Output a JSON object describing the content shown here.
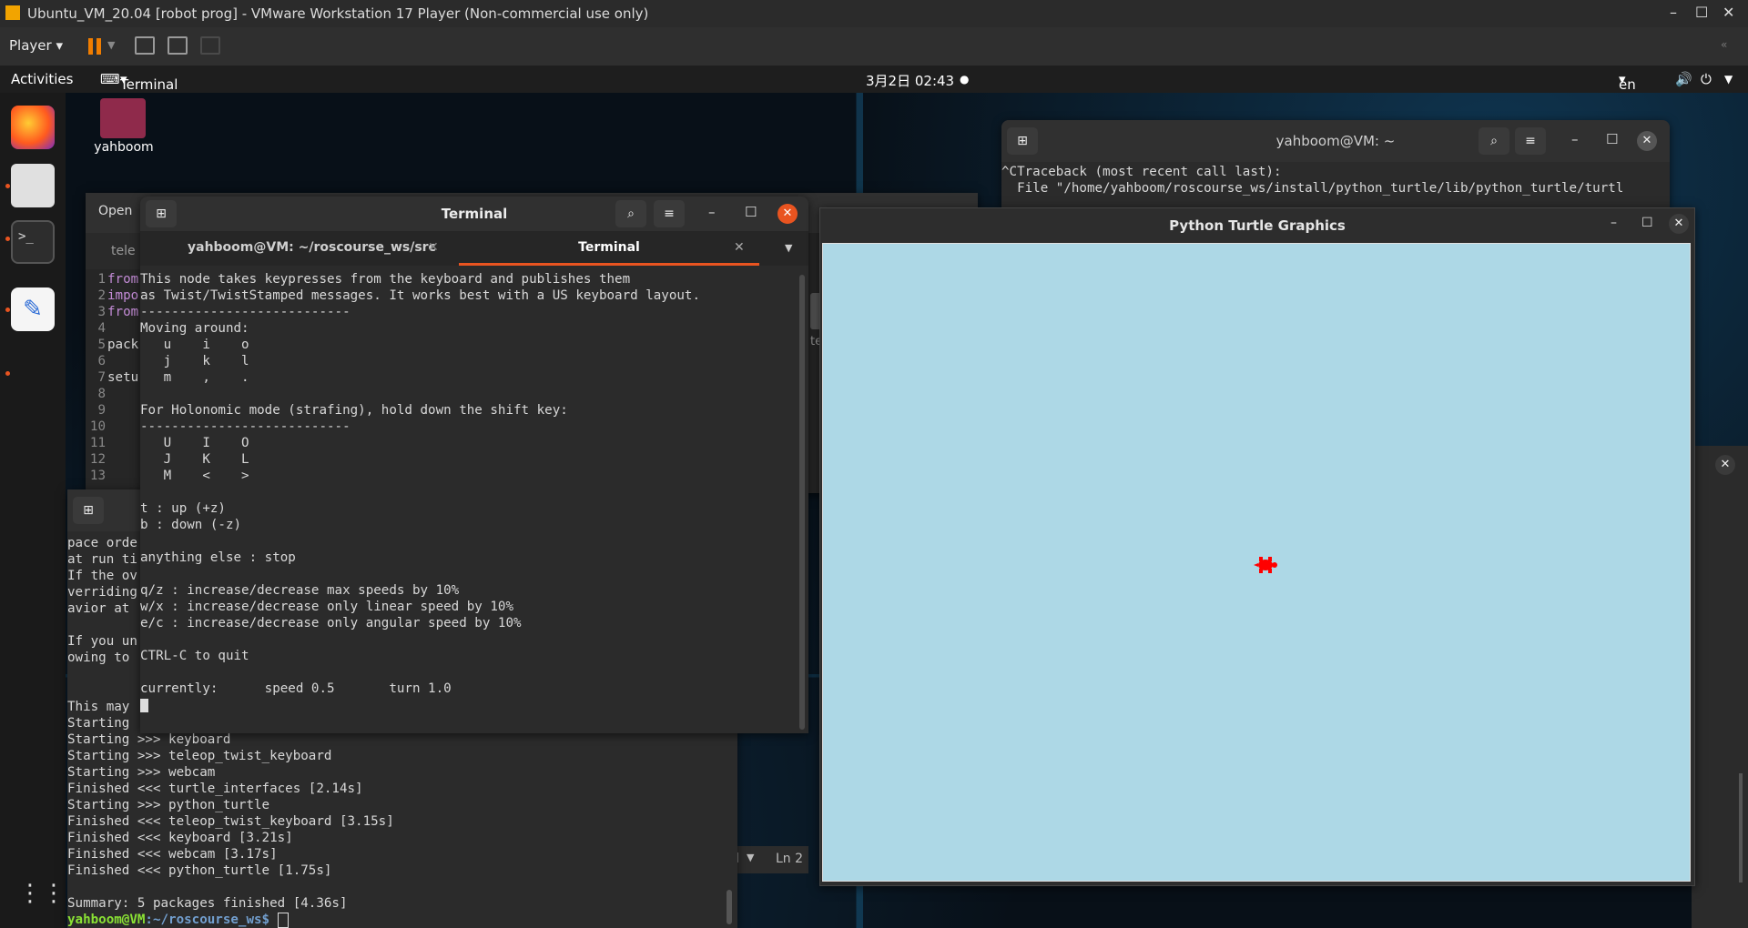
{
  "vmware": {
    "title": "Ubuntu_VM_20.04 [robot prog] - VMware Workstation 17 Player (Non-commercial use only)",
    "player_label": "Player",
    "controls": [
      "–",
      "☐",
      "✕"
    ]
  },
  "topbar": {
    "activities": "Activities",
    "app": "Terminal",
    "clock": "3月2日  02:43",
    "language": "en"
  },
  "desktop": {
    "home_label": "yahboom"
  },
  "editor": {
    "open_label": "Open",
    "tab_label": "tele",
    "lines": [
      "1",
      "2",
      "3",
      "4",
      "5",
      "6",
      "7",
      "8",
      "9",
      "10",
      "11",
      "12",
      "13"
    ],
    "code": [
      "from",
      "impo",
      "from",
      "",
      "pack",
      "",
      "setu",
      "",
      "",
      "",
      "",
      "",
      ""
    ],
    "status_ln": "Ln 2",
    "status_mode": "l"
  },
  "back_terminal": {
    "lines": [
      "pace orde",
      "at run ti",
      "If the ov",
      "verriding",
      "avior at",
      "",
      "If you un",
      "owing to",
      "",
      "",
      "This may",
      "Starting",
      "Starting >>> keyboard",
      "Starting >>> teleop_twist_keyboard",
      "Starting >>> webcam",
      "Finished <<< turtle_interfaces [2.14s]",
      "Starting >>> python_turtle",
      "Finished <<< teleop_twist_keyboard [3.15s]",
      "Finished <<< keyboard [3.21s]",
      "Finished <<< webcam [3.17s]",
      "Finished <<< python_turtle [1.75s]",
      "",
      "Summary: 5 packages finished [4.36s]"
    ],
    "prompt_user": "yahboom@VM",
    "prompt_path": ":~/roscourse_ws$"
  },
  "main_terminal": {
    "title": "Terminal",
    "tabs": [
      {
        "label": "yahboom@VM: ~/roscourse_ws/src"
      },
      {
        "label": "Terminal"
      }
    ],
    "lines": [
      "This node takes keypresses from the keyboard and publishes them",
      "as Twist/TwistStamped messages. It works best with a US keyboard layout.",
      "---------------------------",
      "Moving around:",
      "   u    i    o",
      "   j    k    l",
      "   m    ,    .",
      "",
      "For Holonomic mode (strafing), hold down the shift key:",
      "---------------------------",
      "   U    I    O",
      "   J    K    L",
      "   M    <    >",
      "",
      "t : up (+z)",
      "b : down (-z)",
      "",
      "anything else : stop",
      "",
      "q/z : increase/decrease max speeds by 10%",
      "w/x : increase/decrease only linear speed by 10%",
      "e/c : increase/decrease only angular speed by 10%",
      "",
      "CTRL-C to quit",
      "",
      "currently:      speed 0.5       turn 1.0"
    ]
  },
  "right_terminal": {
    "title": "yahboom@VM: ~",
    "lines": [
      "^CTraceback (most recent call last):",
      "  File \"/home/yahboom/roscourse_ws/install/python_turtle/lib/python_turtle/turtl"
    ]
  },
  "turtle_window": {
    "title": "Python Turtle Graphics",
    "canvas_color": "#add8e6",
    "turtle_color": "#ff0000"
  },
  "colors": {
    "accent": "#e95420",
    "vm_orange": "#f07d00"
  }
}
